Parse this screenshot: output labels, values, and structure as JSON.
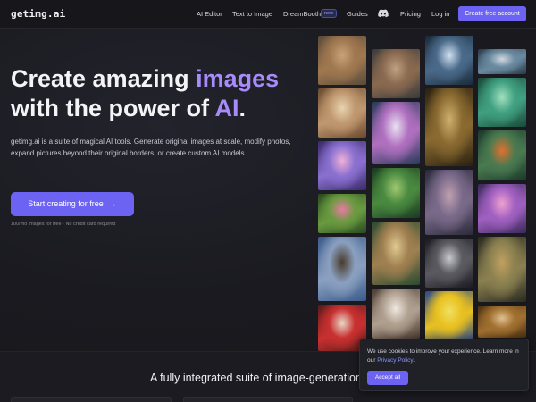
{
  "header": {
    "logo": "getimg.ai",
    "nav": [
      "AI Editor",
      "Text to Image",
      "DreamBooth",
      "Guides",
      "Pricing",
      "Log in"
    ],
    "new_badge": "new",
    "discord_icon": "discord-icon",
    "cta": "Create free account"
  },
  "hero": {
    "headline_line1_prefix": "Create amazing ",
    "headline_line1_accent": "images",
    "headline_line2_prefix": "with the power of ",
    "headline_line2_accent": "AI",
    "headline_line2_suffix": ".",
    "description": "getimg.ai is a suite of magical AI tools. Generate original images at scale, modify photos, expand pictures beyond their original borders, or create custom AI models.",
    "cta": "Start creating for free",
    "cta_icon": "arrow-right-icon",
    "fine_print": "100/mo images for free · No credit card required"
  },
  "gallery": {
    "tiles": [
      {
        "name": "portrait-man-glasses",
        "colors": [
          "#5a4a3a",
          "#a07850",
          "#c9a27a"
        ]
      },
      {
        "name": "bedroom-interior",
        "colors": [
          "#6b4a2e",
          "#c09870",
          "#e8d4b0"
        ]
      },
      {
        "name": "fluffy-cat",
        "colors": [
          "#3a2a6a",
          "#8a70d0",
          "#f0b0d8"
        ]
      },
      {
        "name": "rose-bush",
        "colors": [
          "#2a4a20",
          "#6a9a40",
          "#e87aa0"
        ]
      },
      {
        "name": "horse-rider",
        "colors": [
          "#3a5a8a",
          "#8aa0c0",
          "#4a3a2a"
        ]
      },
      {
        "name": "santa-woman",
        "colors": [
          "#5a1a1a",
          "#c83030",
          "#e8d8c8"
        ]
      },
      {
        "name": "curly-hair-man",
        "colors": [
          "#3a3a3a",
          "#8a6a50",
          "#c0a080"
        ]
      },
      {
        "name": "flower-goddess",
        "colors": [
          "#2a3a5a",
          "#b070c0",
          "#e8e0f0"
        ]
      },
      {
        "name": "green-trees",
        "colors": [
          "#1a3a20",
          "#4a8a40",
          "#a0c870"
        ]
      },
      {
        "name": "jungle-pyramid",
        "colors": [
          "#2a4a30",
          "#a08050",
          "#e0c890"
        ]
      },
      {
        "name": "church-interior",
        "colors": [
          "#4a3a30",
          "#b0a090",
          "#f0e8e0"
        ]
      },
      {
        "name": "ocean-wave",
        "colors": [
          "#1a2a3a",
          "#4a6a8a",
          "#d0e0f0"
        ]
      },
      {
        "name": "golden-mask",
        "colors": [
          "#2a2010",
          "#8a6a30",
          "#d0b070"
        ]
      },
      {
        "name": "misty-forest",
        "colors": [
          "#2a2a3a",
          "#7a6a8a",
          "#c0a0b0"
        ]
      },
      {
        "name": "gray-sneaker",
        "colors": [
          "#1a1a20",
          "#5a5a60",
          "#c8c8d0"
        ]
      },
      {
        "name": "pikachu",
        "colors": [
          "#2a4a8a",
          "#e8c020",
          "#f0e060"
        ]
      },
      {
        "name": "lake-mountains",
        "colors": [
          "#2a3a4a",
          "#6a8aa0",
          "#d0d8e0"
        ]
      },
      {
        "name": "green-hair-woman",
        "colors": [
          "#1a4a3a",
          "#40a080",
          "#a0e0c0"
        ]
      },
      {
        "name": "koi-fish",
        "colors": [
          "#1a3a2a",
          "#4a7a50",
          "#e07030"
        ]
      },
      {
        "name": "hamster",
        "colors": [
          "#3a2a5a",
          "#a060c0",
          "#f0a0d0"
        ]
      },
      {
        "name": "feathered-woman",
        "colors": [
          "#2a2a20",
          "#8a8050",
          "#c0a060"
        ]
      },
      {
        "name": "painted-portrait",
        "colors": [
          "#4a3010",
          "#a07030",
          "#e0c090"
        ]
      }
    ]
  },
  "features": {
    "title": "A fully integrated suite of image-generation"
  },
  "cookie": {
    "text": "We use cookies to improve your experience. Learn more in our ",
    "link": "Privacy Policy",
    "suffix": ".",
    "button": "Accept all"
  },
  "colors": {
    "accent": "#6c63f3",
    "headline_accent": "#a78bfa",
    "background": "#17171c"
  }
}
